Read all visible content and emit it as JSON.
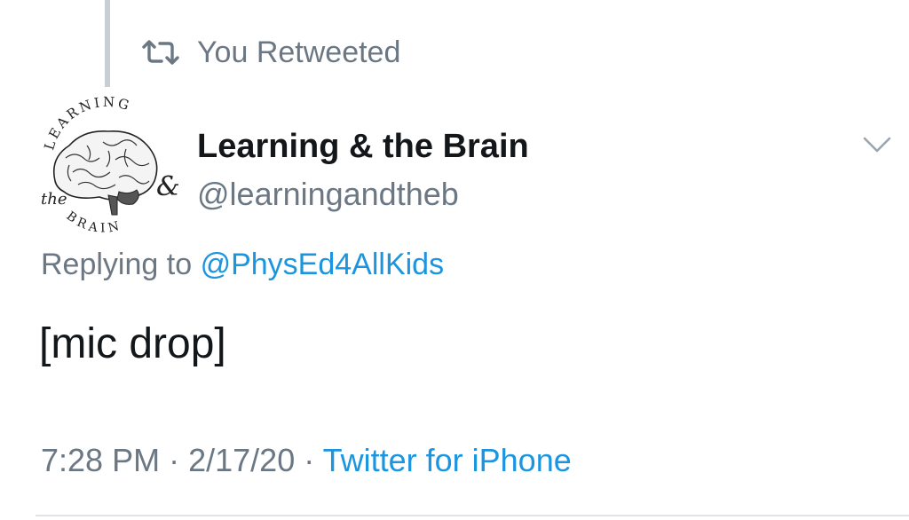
{
  "retweet": {
    "icon": "retweet-icon",
    "label": "You Retweeted"
  },
  "author": {
    "avatar_icon": "brain-logo-avatar",
    "avatar_logo_text": "LEARNING & the BRAIN",
    "display_name": "Learning & the Brain",
    "handle": "@learningandtheb"
  },
  "menu": {
    "icon": "chevron-down-icon"
  },
  "reply": {
    "prefix": "Replying to",
    "mention": "@PhysEd4AllKids"
  },
  "tweet": {
    "text": "[mic drop]"
  },
  "meta": {
    "time": "7:28 PM",
    "separator_1": "·",
    "date": "2/17/20",
    "separator_2": "·",
    "source": "Twitter for iPhone"
  },
  "colors": {
    "link": "#1b95e0",
    "secondary_text": "#6b7884",
    "primary_text": "#14171a",
    "thread_line": "#c7ced4"
  }
}
